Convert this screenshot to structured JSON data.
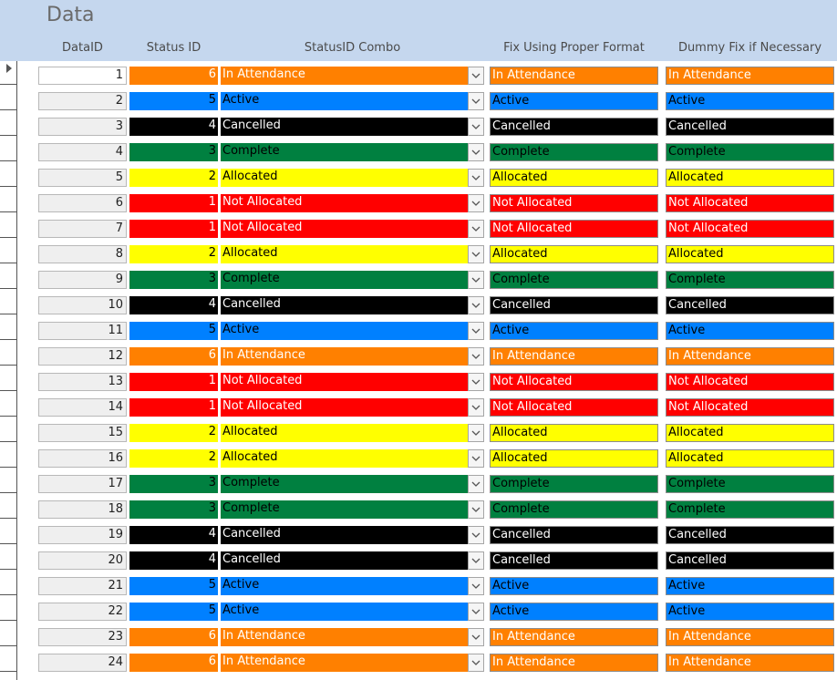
{
  "form": {
    "title": "Data",
    "columns": {
      "data_id": "DataID",
      "status_id": "Status ID",
      "combo": "StatusID Combo",
      "fix": "Fix Using Proper Format",
      "dummy": "Dummy Fix if Necessary"
    }
  },
  "status_styles": {
    "1": {
      "bg": "#ff0000",
      "fg": "#ffffff"
    },
    "2": {
      "bg": "#ffff00",
      "fg": "#000000"
    },
    "3": {
      "bg": "#008040",
      "fg": "#000000"
    },
    "4": {
      "bg": "#000000",
      "fg": "#ffffff"
    },
    "5": {
      "bg": "#0080ff",
      "fg": "#000000"
    },
    "6": {
      "bg": "#ff8000",
      "fg": "#ffffff"
    }
  },
  "rows": [
    {
      "data_id": "1",
      "status_id": "6",
      "status": "In Attendance"
    },
    {
      "data_id": "2",
      "status_id": "5",
      "status": "Active"
    },
    {
      "data_id": "3",
      "status_id": "4",
      "status": "Cancelled"
    },
    {
      "data_id": "4",
      "status_id": "3",
      "status": "Complete"
    },
    {
      "data_id": "5",
      "status_id": "2",
      "status": "Allocated"
    },
    {
      "data_id": "6",
      "status_id": "1",
      "status": "Not Allocated"
    },
    {
      "data_id": "7",
      "status_id": "1",
      "status": "Not Allocated"
    },
    {
      "data_id": "8",
      "status_id": "2",
      "status": "Allocated"
    },
    {
      "data_id": "9",
      "status_id": "3",
      "status": "Complete"
    },
    {
      "data_id": "10",
      "status_id": "4",
      "status": "Cancelled"
    },
    {
      "data_id": "11",
      "status_id": "5",
      "status": "Active"
    },
    {
      "data_id": "12",
      "status_id": "6",
      "status": "In Attendance"
    },
    {
      "data_id": "13",
      "status_id": "1",
      "status": "Not Allocated"
    },
    {
      "data_id": "14",
      "status_id": "1",
      "status": "Not Allocated"
    },
    {
      "data_id": "15",
      "status_id": "2",
      "status": "Allocated"
    },
    {
      "data_id": "16",
      "status_id": "2",
      "status": "Allocated"
    },
    {
      "data_id": "17",
      "status_id": "3",
      "status": "Complete"
    },
    {
      "data_id": "18",
      "status_id": "3",
      "status": "Complete"
    },
    {
      "data_id": "19",
      "status_id": "4",
      "status": "Cancelled"
    },
    {
      "data_id": "20",
      "status_id": "4",
      "status": "Cancelled"
    },
    {
      "data_id": "21",
      "status_id": "5",
      "status": "Active"
    },
    {
      "data_id": "22",
      "status_id": "5",
      "status": "Active"
    },
    {
      "data_id": "23",
      "status_id": "6",
      "status": "In Attendance"
    },
    {
      "data_id": "24",
      "status_id": "6",
      "status": "In Attendance"
    }
  ],
  "current_row_icon": "record-selector-arrow-icon",
  "dropdown_icon": "chevron-down-icon"
}
